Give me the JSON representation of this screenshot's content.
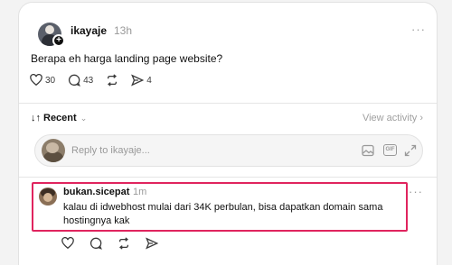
{
  "post": {
    "username": "ikayaje",
    "timestamp": "13h",
    "more": "···",
    "text": "Berapa eh harga landing page website?",
    "likes": "30",
    "comments": "43",
    "shares": "4"
  },
  "sort": {
    "icon": "↓↑",
    "label": "Recent",
    "chevron": "⌄",
    "view_activity": "View activity ›"
  },
  "reply_box": {
    "placeholder": "Reply to ikayaje...",
    "gif": "GIF"
  },
  "comment": {
    "username": "bukan.sicepat",
    "timestamp": "1m",
    "more": "···",
    "text": "kalau di idwebhost mulai dari 34K perbulan, bisa dapatkan domain sama hostingnya kak"
  },
  "colors": {
    "highlight": "#e0245e",
    "muted": "#999999"
  }
}
